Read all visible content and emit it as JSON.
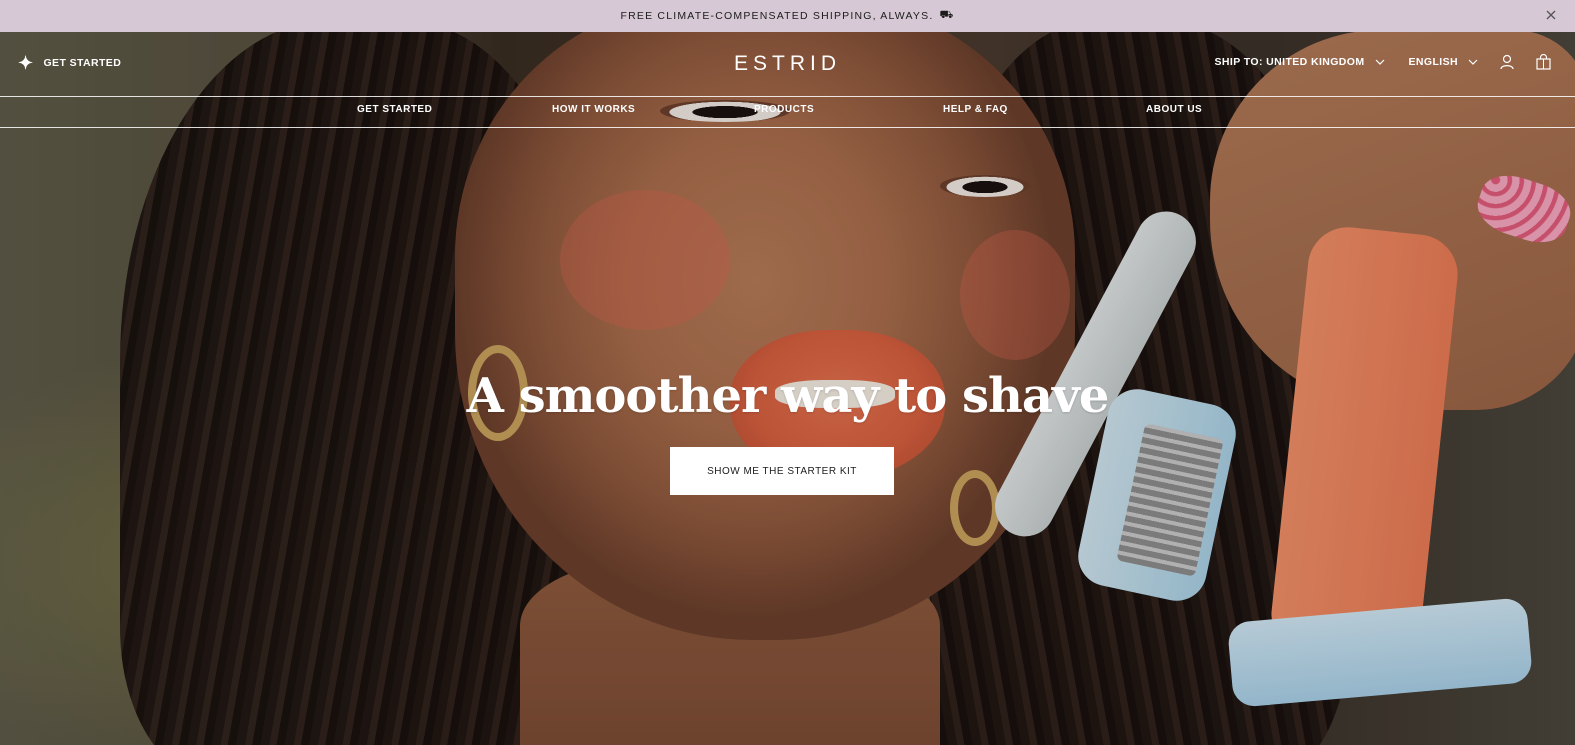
{
  "announcement": {
    "text": "FREE CLIMATE-COMPENSATED SHIPPING, ALWAYS.",
    "icon": "truck-icon",
    "close_icon": "close-icon",
    "background": "#d6c8d4"
  },
  "header": {
    "get_started": "GET STARTED",
    "get_started_icon": "sparkle-icon",
    "logo": "ESTRID",
    "ship_to": "SHIP TO: UNITED KINGDOM",
    "language": "ENGLISH",
    "account_icon": "user-icon",
    "cart_icon": "bag-icon"
  },
  "nav": {
    "items": [
      {
        "label": "GET STARTED"
      },
      {
        "label": "HOW IT WORKS"
      },
      {
        "label": "PRODUCTS"
      },
      {
        "label": "HELP & FAQ"
      },
      {
        "label": "ABOUT US"
      }
    ]
  },
  "hero": {
    "headline": "A smoother way to shave",
    "cta_label": "SHOW ME THE STARTER KIT"
  }
}
